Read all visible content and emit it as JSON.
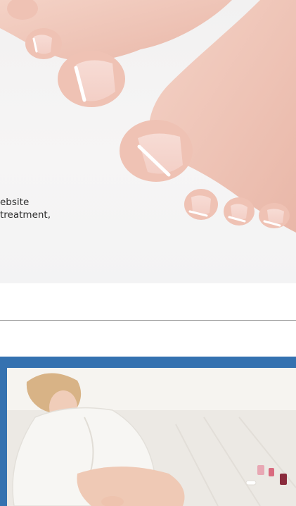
{
  "hero": {
    "image": "feet-with-french-pedicure",
    "caption_lines": [
      "ebsite",
      "treatment,"
    ]
  },
  "section_image": {
    "image": "woman-in-white-robe-painting-toenails",
    "frame_color": "#3572b0"
  }
}
